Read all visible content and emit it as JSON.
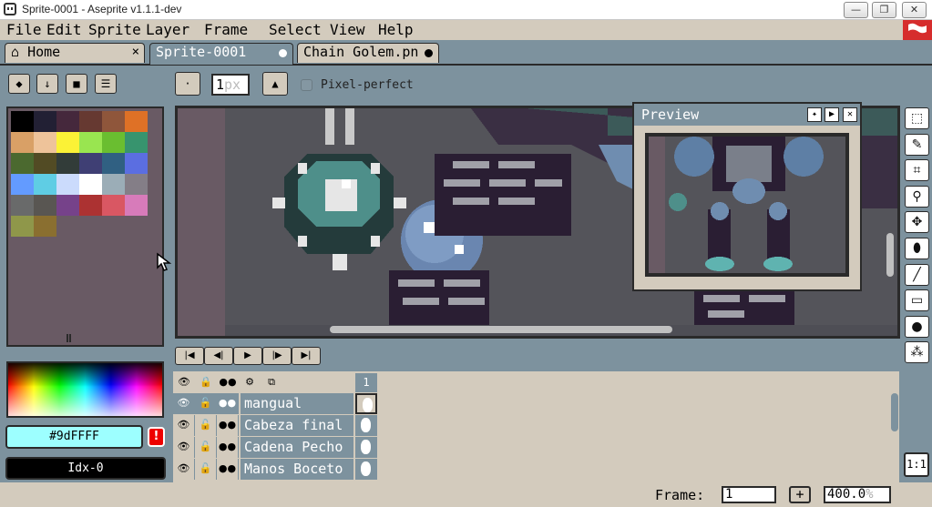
{
  "window": {
    "title": "Sprite-0001 - Aseprite v1.1.1-dev",
    "minimize": "—",
    "maximize": "❐",
    "close": "✕"
  },
  "menu": [
    "File",
    "Edit",
    "Sprite",
    "Layer",
    "Frame",
    "Select",
    "View",
    "Help"
  ],
  "tabs": [
    {
      "label": "Home",
      "close": "×"
    },
    {
      "label": "Sprite-0001"
    },
    {
      "label": "Chain Golem.pn"
    }
  ],
  "toolbar": {
    "brush_size_value": "1",
    "brush_size_unit": "px",
    "pixel_perfect_label": "Pixel-perfect"
  },
  "palette": {
    "colors": [
      "#000000",
      "#222034",
      "#45283c",
      "#663931",
      "#8f563b",
      "#df7126",
      "#d9a066",
      "#eec39a",
      "#fbf236",
      "#99e550",
      "#6abe30",
      "#37946e",
      "#4b692f",
      "#524b24",
      "#323c39",
      "#3f3f74",
      "#306082",
      "#5b6ee1",
      "#639bff",
      "#5fcde4",
      "#cbdbfc",
      "#ffffff",
      "#9badb7",
      "#847e87",
      "#696a6a",
      "#595652",
      "#76428a",
      "#ac3232",
      "#d95763",
      "#d77bba",
      "#8f974a",
      "#8a6f30"
    ]
  },
  "color": {
    "hex": "#9dFFFF",
    "index": "Idx-0",
    "warning": "!"
  },
  "preview": {
    "title": "Preview"
  },
  "tools": [
    "marquee",
    "pencil",
    "eyedropper",
    "zoom",
    "move",
    "fill",
    "line",
    "rectangle",
    "blur",
    "spray"
  ],
  "tool_glyphs": [
    "⬚",
    "✎",
    "⌗",
    "⚲",
    "✥",
    "⬮",
    "╱",
    "▭",
    "●",
    "⁂"
  ],
  "zoom_button": "1:1",
  "animation": [
    "|◀",
    "◀|",
    "▶",
    "|▶",
    "▶|"
  ],
  "timeline": {
    "frame_number": "1",
    "layers": [
      {
        "name": "mangual",
        "active": true
      },
      {
        "name": "Cabeza final",
        "active": false
      },
      {
        "name": "Cadena Pecho",
        "active": false
      },
      {
        "name": "Manos Boceto",
        "active": false
      }
    ]
  },
  "status": {
    "frame_label": "Frame:",
    "frame_value": "1",
    "plus": "+",
    "zoom_value": "400.0",
    "zoom_unit": "%"
  }
}
